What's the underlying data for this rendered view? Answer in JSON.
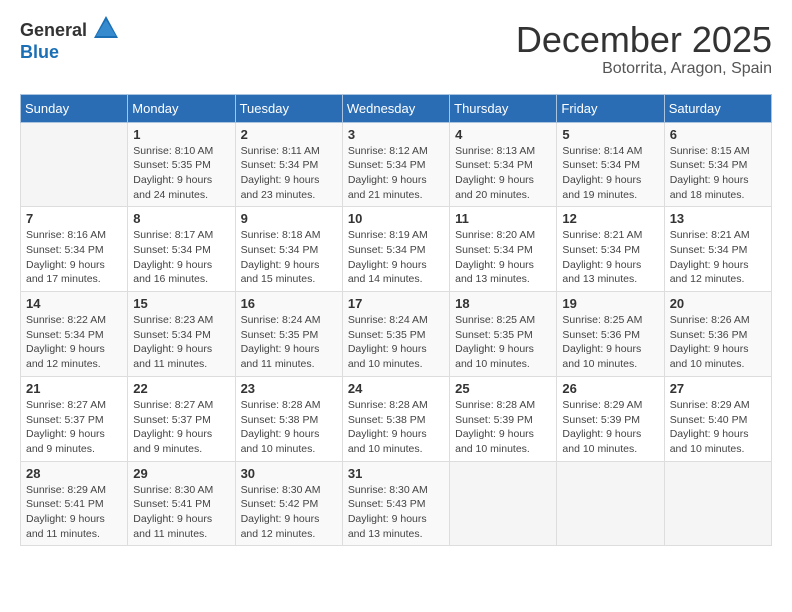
{
  "logo": {
    "general": "General",
    "blue": "Blue"
  },
  "title": "December 2025",
  "subtitle": "Botorrita, Aragon, Spain",
  "weekdays": [
    "Sunday",
    "Monday",
    "Tuesday",
    "Wednesday",
    "Thursday",
    "Friday",
    "Saturday"
  ],
  "weeks": [
    [
      {
        "date": "",
        "empty": true
      },
      {
        "date": "1",
        "sunrise": "8:10 AM",
        "sunset": "5:35 PM",
        "daylight": "9 hours and 24 minutes."
      },
      {
        "date": "2",
        "sunrise": "8:11 AM",
        "sunset": "5:34 PM",
        "daylight": "9 hours and 23 minutes."
      },
      {
        "date": "3",
        "sunrise": "8:12 AM",
        "sunset": "5:34 PM",
        "daylight": "9 hours and 21 minutes."
      },
      {
        "date": "4",
        "sunrise": "8:13 AM",
        "sunset": "5:34 PM",
        "daylight": "9 hours and 20 minutes."
      },
      {
        "date": "5",
        "sunrise": "8:14 AM",
        "sunset": "5:34 PM",
        "daylight": "9 hours and 19 minutes."
      },
      {
        "date": "6",
        "sunrise": "8:15 AM",
        "sunset": "5:34 PM",
        "daylight": "9 hours and 18 minutes."
      }
    ],
    [
      {
        "date": "7",
        "sunrise": "8:16 AM",
        "sunset": "5:34 PM",
        "daylight": "9 hours and 17 minutes."
      },
      {
        "date": "8",
        "sunrise": "8:17 AM",
        "sunset": "5:34 PM",
        "daylight": "9 hours and 16 minutes."
      },
      {
        "date": "9",
        "sunrise": "8:18 AM",
        "sunset": "5:34 PM",
        "daylight": "9 hours and 15 minutes."
      },
      {
        "date": "10",
        "sunrise": "8:19 AM",
        "sunset": "5:34 PM",
        "daylight": "9 hours and 14 minutes."
      },
      {
        "date": "11",
        "sunrise": "8:20 AM",
        "sunset": "5:34 PM",
        "daylight": "9 hours and 13 minutes."
      },
      {
        "date": "12",
        "sunrise": "8:21 AM",
        "sunset": "5:34 PM",
        "daylight": "9 hours and 13 minutes."
      },
      {
        "date": "13",
        "sunrise": "8:21 AM",
        "sunset": "5:34 PM",
        "daylight": "9 hours and 12 minutes."
      }
    ],
    [
      {
        "date": "14",
        "sunrise": "8:22 AM",
        "sunset": "5:34 PM",
        "daylight": "9 hours and 12 minutes."
      },
      {
        "date": "15",
        "sunrise": "8:23 AM",
        "sunset": "5:34 PM",
        "daylight": "9 hours and 11 minutes."
      },
      {
        "date": "16",
        "sunrise": "8:24 AM",
        "sunset": "5:35 PM",
        "daylight": "9 hours and 11 minutes."
      },
      {
        "date": "17",
        "sunrise": "8:24 AM",
        "sunset": "5:35 PM",
        "daylight": "9 hours and 10 minutes."
      },
      {
        "date": "18",
        "sunrise": "8:25 AM",
        "sunset": "5:35 PM",
        "daylight": "9 hours and 10 minutes."
      },
      {
        "date": "19",
        "sunrise": "8:25 AM",
        "sunset": "5:36 PM",
        "daylight": "9 hours and 10 minutes."
      },
      {
        "date": "20",
        "sunrise": "8:26 AM",
        "sunset": "5:36 PM",
        "daylight": "9 hours and 10 minutes."
      }
    ],
    [
      {
        "date": "21",
        "sunrise": "8:27 AM",
        "sunset": "5:37 PM",
        "daylight": "9 hours and 9 minutes."
      },
      {
        "date": "22",
        "sunrise": "8:27 AM",
        "sunset": "5:37 PM",
        "daylight": "9 hours and 9 minutes."
      },
      {
        "date": "23",
        "sunrise": "8:28 AM",
        "sunset": "5:38 PM",
        "daylight": "9 hours and 10 minutes."
      },
      {
        "date": "24",
        "sunrise": "8:28 AM",
        "sunset": "5:38 PM",
        "daylight": "9 hours and 10 minutes."
      },
      {
        "date": "25",
        "sunrise": "8:28 AM",
        "sunset": "5:39 PM",
        "daylight": "9 hours and 10 minutes."
      },
      {
        "date": "26",
        "sunrise": "8:29 AM",
        "sunset": "5:39 PM",
        "daylight": "9 hours and 10 minutes."
      },
      {
        "date": "27",
        "sunrise": "8:29 AM",
        "sunset": "5:40 PM",
        "daylight": "9 hours and 10 minutes."
      }
    ],
    [
      {
        "date": "28",
        "sunrise": "8:29 AM",
        "sunset": "5:41 PM",
        "daylight": "9 hours and 11 minutes."
      },
      {
        "date": "29",
        "sunrise": "8:30 AM",
        "sunset": "5:41 PM",
        "daylight": "9 hours and 11 minutes."
      },
      {
        "date": "30",
        "sunrise": "8:30 AM",
        "sunset": "5:42 PM",
        "daylight": "9 hours and 12 minutes."
      },
      {
        "date": "31",
        "sunrise": "8:30 AM",
        "sunset": "5:43 PM",
        "daylight": "9 hours and 13 minutes."
      },
      {
        "date": "",
        "empty": true
      },
      {
        "date": "",
        "empty": true
      },
      {
        "date": "",
        "empty": true
      }
    ]
  ],
  "labels": {
    "sunrise": "Sunrise:",
    "sunset": "Sunset:",
    "daylight": "Daylight:"
  }
}
